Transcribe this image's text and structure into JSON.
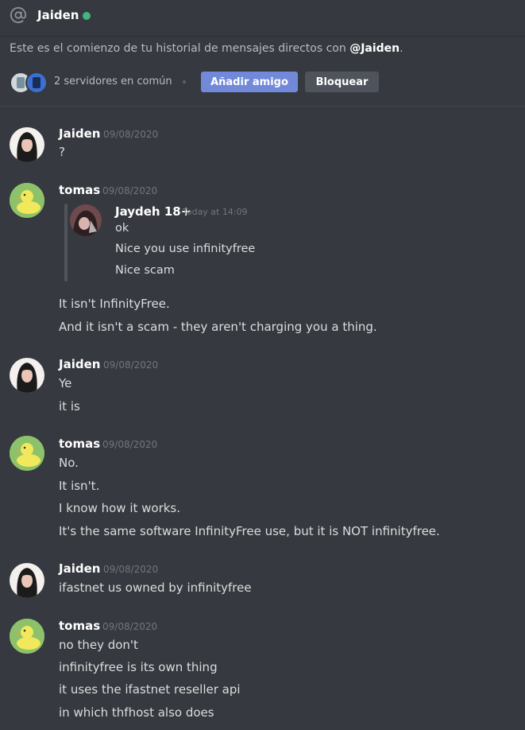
{
  "header": {
    "title": "Jaiden",
    "status": "online",
    "status_color": "#43b581"
  },
  "intro": {
    "text": "Este es el comienzo de tu historial de mensajes directos con ",
    "handle": "@Jaiden",
    "suffix": "."
  },
  "profile_bar": {
    "mutual_servers": "2 servidores en común",
    "add_friend_label": "Añadir amigo",
    "block_label": "Bloquear",
    "accent": "#7289da"
  },
  "messages": [
    {
      "author": "Jaiden",
      "timestamp": "09/08/2020",
      "lines": [
        "?"
      ]
    },
    {
      "author": "tomas",
      "timestamp": "09/08/2020",
      "quote": {
        "author": "Jaydeh 18+",
        "timestamp": "Today at 14:09",
        "lines": [
          "ok",
          "Nice you use infinityfree",
          "Nice scam"
        ]
      },
      "lines": [
        "It isn't InfinityFree.",
        "And it isn't a scam - they aren't charging you a thing."
      ]
    },
    {
      "author": "Jaiden",
      "timestamp": "09/08/2020",
      "lines": [
        "Ye",
        "it is"
      ]
    },
    {
      "author": "tomas",
      "timestamp": "09/08/2020",
      "lines": [
        "No.",
        "It isn't.",
        "I know how it works.",
        "It's the same software InfinityFree use, but it is  NOT infinityfree."
      ]
    },
    {
      "author": "Jaiden",
      "timestamp": "09/08/2020",
      "lines": [
        "ifastnet us owned by infinityfree"
      ]
    },
    {
      "author": "tomas",
      "timestamp": "09/08/2020",
      "lines": [
        "no they don't",
        "infinityfree is its own thing",
        "it uses the ifastnet reseller api",
        "in which thfhost also does"
      ]
    }
  ]
}
